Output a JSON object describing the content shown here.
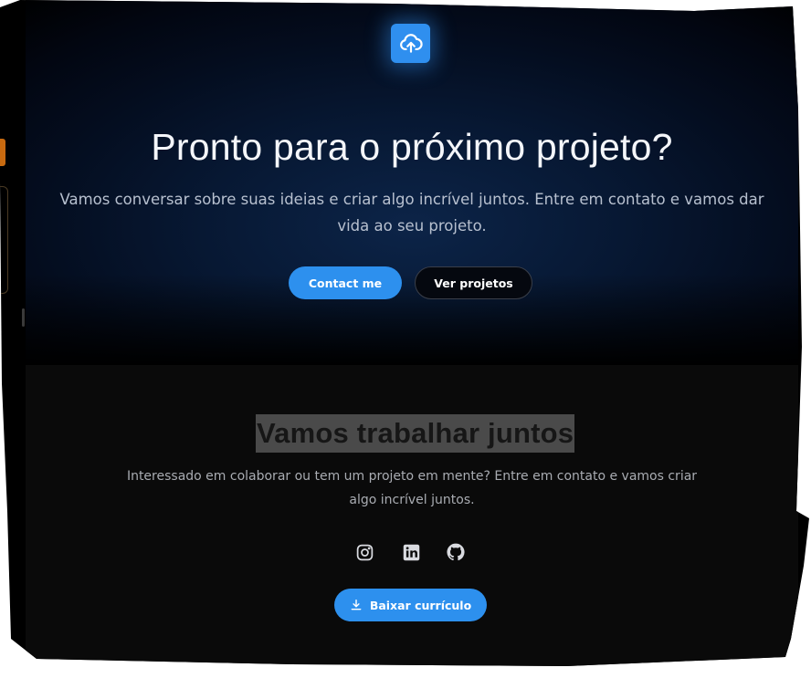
{
  "hero": {
    "logo_icon": "cloud-upload-icon",
    "title": "Pronto para o próximo projeto?",
    "subtitle": "Vamos conversar sobre suas ideias e criar algo incrível juntos. Entre em contato e vamos dar vida ao seu projeto.",
    "primary_button": "Contact me",
    "secondary_button": "Ver projetos"
  },
  "collaborate": {
    "title": "Vamos trabalhar juntos",
    "subtitle": "Interessado em colaborar ou tem um projeto em mente? Entre em contato e vamos criar algo incrível juntos.",
    "social_icons": [
      "instagram-icon",
      "linkedin-icon",
      "github-icon"
    ],
    "download_icon": "download-icon",
    "download_button": "Baixar currículo"
  },
  "colors": {
    "accent": "#2d90ee",
    "background": "#0a0a0a",
    "sidebar_accent": "#c86a10"
  }
}
